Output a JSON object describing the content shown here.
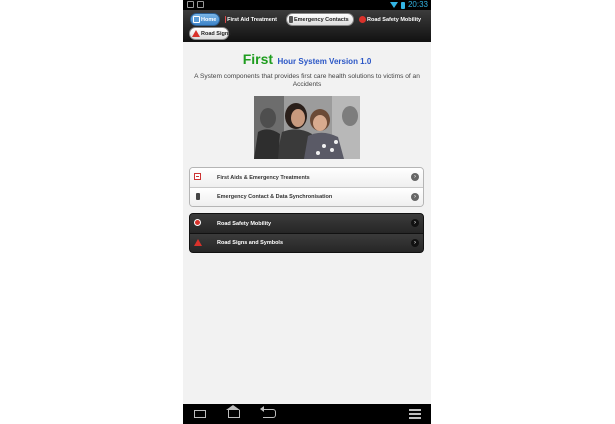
{
  "status_bar": {
    "time": "20:33"
  },
  "tabs": {
    "home": "Home",
    "first_aid": "First Aid Treatment",
    "emergency": "Emergency Contacts",
    "road_safety": "Road Safety Mobility",
    "road_signs": "Road Signs"
  },
  "title": {
    "main": "First",
    "sub": "Hour System Version 1.0"
  },
  "description": "A System components that provides first care health solutions to victims of an Accidents",
  "list_light": [
    {
      "label": "First Aids & Emergency Treatments",
      "icon": "first-aid-icon"
    },
    {
      "label": "Emergency Contact & Data Synchronisation",
      "icon": "phone-icon"
    }
  ],
  "list_dark": [
    {
      "label": "Road Safety Mobility",
      "icon": "stop-sign-icon"
    },
    {
      "label": "Road Signs and Symbols",
      "icon": "warning-triangle-icon"
    }
  ],
  "colors": {
    "title_green": "#1f9d1f",
    "title_blue": "#2a56c6",
    "accent": "#33b5e5"
  }
}
